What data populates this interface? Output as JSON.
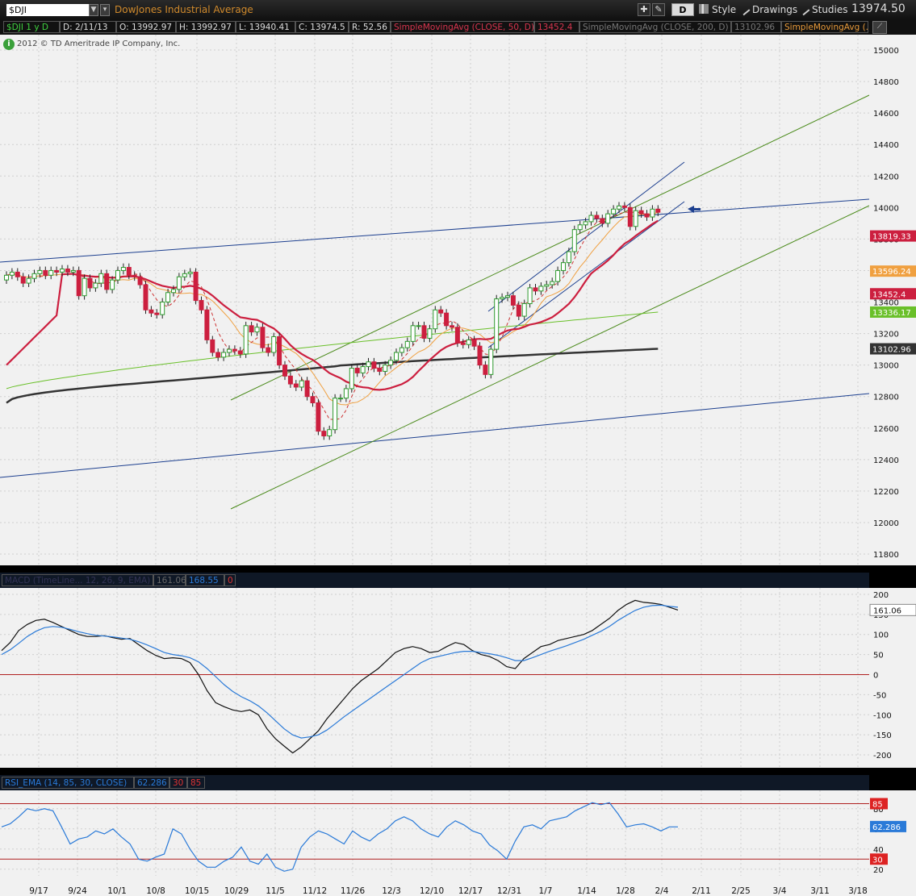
{
  "toolbar": {
    "symbol": "$DJI",
    "symbol_description": "DowJones Industrial Average",
    "aggregation": "D",
    "style_label": "Style",
    "drawings_label": "Drawings",
    "studies_label": "Studies",
    "last_price": "13974.50"
  },
  "infobar": {
    "symbol_period": "$DJI 1 y D",
    "date": "D: 2/11/13",
    "open": "O: 13992.97",
    "high": "H: 13992.97",
    "low": "L: 13940.41",
    "close": "C: 13974.5",
    "range": "R: 52.56",
    "sma50_label": "SimpleMovingAvg (CLOSE, 50, D)",
    "sma50_value": "13452.4",
    "sma200_label": "SimpleMovingAvg (CLOSE, 200, D)",
    "sma200_value": "13102.96",
    "sma_extra_label": "SimpleMovingAvg (..."
  },
  "copyright": "2012 © TD Ameritrade IP Company, Inc.",
  "macd_header": {
    "label": "MACD (TimeLine... 12, 26, 9, EMA)",
    "value1": "161.06",
    "value2": "168.55",
    "value3": "0"
  },
  "rsi_header": {
    "label": "RSI_EMA (14, 85, 30, CLOSE)",
    "value": "62.286",
    "overbought": "30",
    "oversold": "85"
  },
  "colors": {
    "up": "#2e9a2e",
    "down": "#cc1f3f",
    "sma50": "#cc1f3f",
    "sma200": "#333333",
    "sma20": "#f0a040",
    "sma100": "#6ac02a",
    "sma10": "#cc3333",
    "trend_blue": "#1c3f8f",
    "trend_green": "#4a8a1a",
    "macd_line": "#111111",
    "signal_line": "#2a7ad8",
    "rsi_line": "#2a7ad8",
    "zero_line": "#b02020"
  },
  "chart_data": [
    {
      "type": "candlestick",
      "title": "",
      "ylim": [
        11700,
        15100
      ],
      "yticks": [
        11800,
        12000,
        12200,
        12400,
        12600,
        12800,
        13000,
        13200,
        13400,
        13600,
        13800,
        14000,
        14200,
        14400,
        14600,
        14800,
        15000
      ],
      "xtick_labels": [
        "9/17",
        "9/24",
        "10/1",
        "10/8",
        "10/15",
        "10/29",
        "11/5",
        "11/12",
        "11/26",
        "12/3",
        "12/10",
        "12/17",
        "12/31",
        "1/7",
        "1/14",
        "1/28",
        "2/4",
        "2/11",
        "2/25",
        "3/4",
        "3/11",
        "3/18"
      ],
      "price_labels": [
        {
          "value": 13819.33,
          "text": "13819.33",
          "color": "#cc1f3f"
        },
        {
          "value": 13596.24,
          "text": "13596.24",
          "color": "#f0a040"
        },
        {
          "value": 13452.4,
          "text": "13452.4",
          "color": "#cc1f3f"
        },
        {
          "value": 13336.17,
          "text": "13336.17",
          "color": "#6ac02a"
        },
        {
          "value": 13102.96,
          "text": "13102.96",
          "color": "#333333"
        }
      ],
      "candles_close": [
        13570,
        13590,
        13560,
        13520,
        13550,
        13580,
        13600,
        13570,
        13600,
        13590,
        13610,
        13590,
        13600,
        13440,
        13550,
        13490,
        13520,
        13580,
        13480,
        13540,
        13600,
        13620,
        13570,
        13560,
        13510,
        13350,
        13330,
        13320,
        13400,
        13460,
        13480,
        13560,
        13580,
        13590,
        13410,
        13350,
        13160,
        13080,
        13050,
        13080,
        13100,
        13090,
        13070,
        13250,
        13210,
        13240,
        13110,
        13080,
        13180,
        13000,
        12930,
        12880,
        12860,
        12900,
        12800,
        12760,
        12580,
        12550,
        12590,
        12790,
        12790,
        12850,
        12980,
        12950,
        12990,
        13020,
        12980,
        12960,
        13000,
        13030,
        13080,
        13110,
        13150,
        13250,
        13250,
        13170,
        13230,
        13350,
        13330,
        13250,
        13240,
        13140,
        13130,
        13160,
        13120,
        13000,
        12940,
        13100,
        13420,
        13430,
        13440,
        13380,
        13310,
        13390,
        13490,
        13470,
        13500,
        13510,
        13530,
        13600,
        13650,
        13720,
        13860,
        13890,
        13910,
        13950,
        13930,
        13900,
        13960,
        13990,
        14010,
        14000,
        13880,
        13980,
        13960,
        13940,
        13990,
        13970
      ],
      "x_day_index": [
        0,
        117
      ],
      "trendlines": "drawn",
      "arrow_marker": "last-price"
    },
    {
      "type": "line",
      "title": "MACD",
      "ylim": [
        -220,
        210
      ],
      "yticks": [
        200,
        150,
        100,
        50,
        0,
        -50,
        -100,
        -150,
        -200
      ],
      "series": [
        {
          "name": "",
          "color": "#111111",
          "values": [
            60,
            80,
            110,
            125,
            135,
            138,
            130,
            120,
            110,
            100,
            95,
            95,
            97,
            92,
            88,
            90,
            75,
            60,
            48,
            40,
            42,
            40,
            30,
            0,
            -40,
            -70,
            -80,
            -88,
            -92,
            -88,
            -100,
            -135,
            -160,
            -178,
            -195,
            -180,
            -160,
            -140,
            -110,
            -85,
            -60,
            -35,
            -15,
            0,
            15,
            35,
            55,
            65,
            70,
            65,
            55,
            58,
            70,
            80,
            75,
            60,
            50,
            45,
            35,
            20,
            15,
            40,
            55,
            70,
            75,
            85,
            90,
            95,
            100,
            110,
            125,
            140,
            160,
            175,
            185,
            180,
            178,
            175,
            168,
            161
          ]
        },
        {
          "name": "",
          "color": "#2a7ad8",
          "values": [
            50,
            62,
            78,
            95,
            108,
            117,
            120,
            118,
            113,
            107,
            102,
            98,
            96,
            94,
            91,
            88,
            82,
            74,
            65,
            55,
            50,
            47,
            42,
            32,
            15,
            -5,
            -25,
            -42,
            -55,
            -65,
            -78,
            -95,
            -115,
            -135,
            -150,
            -158,
            -155,
            -150,
            -138,
            -122,
            -105,
            -90,
            -75,
            -60,
            -45,
            -30,
            -15,
            0,
            15,
            30,
            40,
            45,
            50,
            55,
            58,
            58,
            55,
            52,
            48,
            42,
            35,
            35,
            42,
            50,
            58,
            65,
            72,
            80,
            88,
            98,
            108,
            120,
            135,
            148,
            160,
            168,
            172,
            173,
            170,
            168
          ]
        }
      ]
    },
    {
      "type": "line",
      "title": "RSI",
      "ylim": [
        15,
        95
      ],
      "yticks": [
        80,
        60,
        40,
        20
      ],
      "bands": [
        85,
        30
      ],
      "series": [
        {
          "name": "",
          "color": "#2a7ad8",
          "values": [
            62,
            65,
            72,
            80,
            78,
            80,
            78,
            62,
            45,
            50,
            52,
            58,
            55,
            60,
            52,
            45,
            30,
            28,
            32,
            35,
            60,
            55,
            40,
            28,
            22,
            22,
            28,
            32,
            42,
            28,
            25,
            35,
            22,
            18,
            20,
            42,
            52,
            58,
            55,
            50,
            45,
            58,
            52,
            48,
            55,
            60,
            68,
            72,
            68,
            60,
            55,
            52,
            62,
            68,
            64,
            58,
            55,
            44,
            38,
            30,
            48,
            62,
            64,
            60,
            68,
            70,
            72,
            78,
            82,
            86,
            84,
            86,
            75,
            62,
            64,
            65,
            62,
            58,
            62,
            62
          ]
        }
      ]
    }
  ]
}
